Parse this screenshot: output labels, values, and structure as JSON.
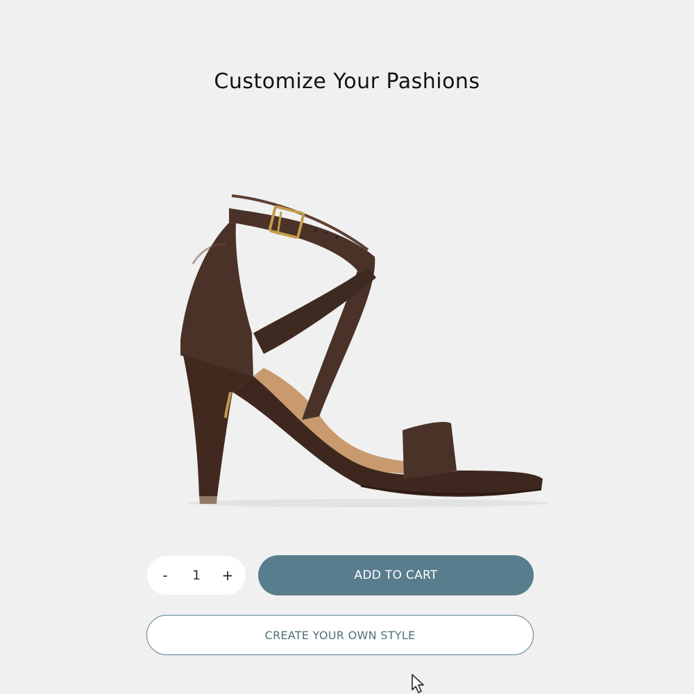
{
  "header": {
    "title": "Customize Your Pashions"
  },
  "product": {
    "image_icon": "strappy-high-heel-sandal",
    "color": "#4a3228"
  },
  "quantity": {
    "decrement_label": "-",
    "value": "1",
    "increment_label": "+"
  },
  "actions": {
    "add_to_cart_label": "ADD TO CART",
    "create_style_label": "CREATE YOUR OWN STYLE"
  },
  "colors": {
    "background": "#f0f0f0",
    "accent": "#587d8d"
  },
  "pointer": {
    "icon": "mouse-pointer-icon"
  }
}
